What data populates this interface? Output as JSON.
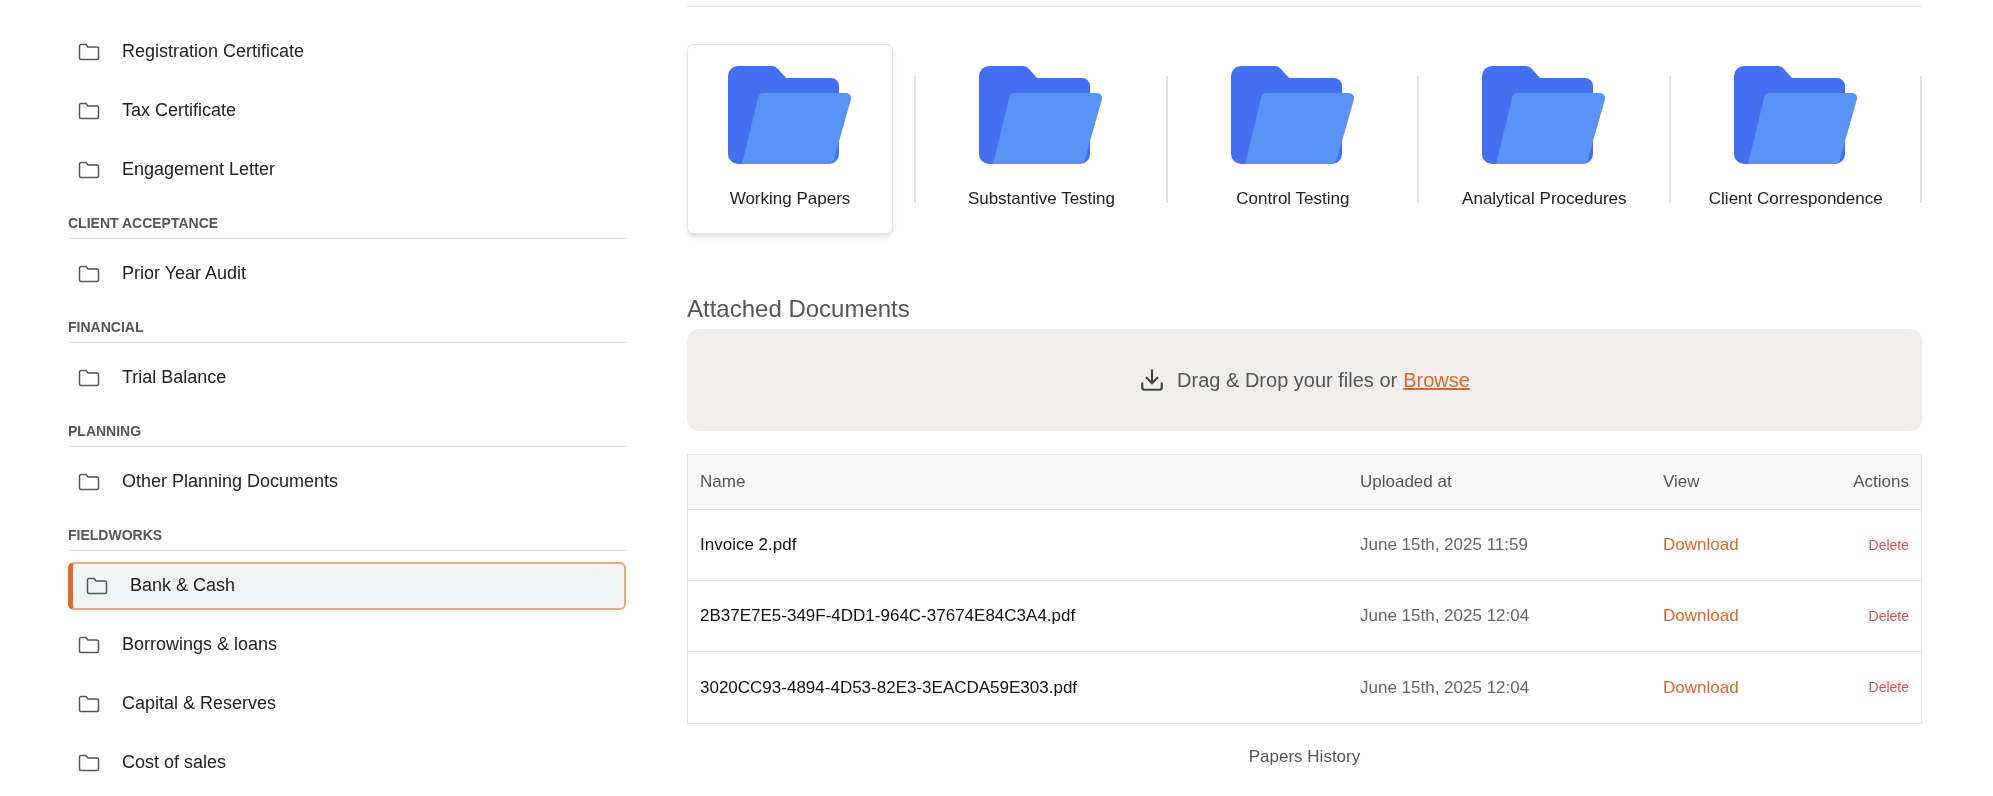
{
  "sidebar": {
    "sections": [
      {
        "items": [
          {
            "label": "Registration Certificate",
            "selected": false
          },
          {
            "label": "Tax Certificate",
            "selected": false
          },
          {
            "label": "Engagement Letter",
            "selected": false
          }
        ]
      },
      {
        "header": "CLIENT ACCEPTANCE",
        "items": [
          {
            "label": "Prior Year Audit",
            "selected": false
          }
        ]
      },
      {
        "header": "FINANCIAL",
        "items": [
          {
            "label": "Trial Balance",
            "selected": false
          }
        ]
      },
      {
        "header": "PLANNING",
        "items": [
          {
            "label": "Other Planning Documents",
            "selected": false
          }
        ]
      },
      {
        "header": "FIELDWORKS",
        "items": [
          {
            "label": "Bank & Cash",
            "selected": true
          },
          {
            "label": "Borrowings & loans",
            "selected": false
          },
          {
            "label": "Capital & Reserves",
            "selected": false
          },
          {
            "label": "Cost of sales",
            "selected": false
          }
        ]
      }
    ]
  },
  "folders": [
    {
      "label": "Working Papers",
      "selected": true
    },
    {
      "label": "Substantive Testing",
      "selected": false
    },
    {
      "label": "Control Testing",
      "selected": false
    },
    {
      "label": "Analytical Procedures",
      "selected": false
    },
    {
      "label": "Client Correspondence",
      "selected": false
    }
  ],
  "attached": {
    "title": "Attached Documents",
    "dropzone": {
      "text": "Drag & Drop your files or",
      "link": "Browse"
    }
  },
  "table": {
    "columns": [
      "Name",
      "Uploaded at",
      "View",
      "Actions"
    ],
    "rows": [
      {
        "name": "Invoice 2.pdf",
        "uploaded": "June 15th, 2025 11:59",
        "view": "Download",
        "action": "Delete"
      },
      {
        "name": "2B37E7E5-349F-4DD1-964C-37674E84C3A4.pdf",
        "uploaded": "June 15th, 2025 12:04",
        "view": "Download",
        "action": "Delete"
      },
      {
        "name": "3020CC93-4894-4D53-82E3-3EACDA59E303.pdf",
        "uploaded": "June 15th, 2025 12:04",
        "view": "Download",
        "action": "Delete"
      }
    ]
  },
  "footer_link": "Papers History"
}
